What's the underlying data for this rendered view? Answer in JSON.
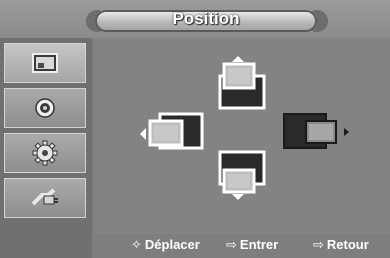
{
  "title": "Position",
  "sidebar": {
    "items": [
      {
        "icon": "picture-icon",
        "active": true
      },
      {
        "icon": "sound-icon",
        "active": false
      },
      {
        "icon": "setup-gear-icon",
        "active": false
      },
      {
        "icon": "input-plug-icon",
        "active": false
      }
    ]
  },
  "controls": {
    "up": "up-arrow-icon",
    "down": "down-arrow-icon",
    "left": "left-arrow-icon",
    "right": "right-arrow-icon"
  },
  "hints": {
    "move_glyph": "✧",
    "move": "Déplacer",
    "enter_glyph": "⇨",
    "enter": "Entrer",
    "back_glyph": "⇨",
    "back": "Retour"
  },
  "colors": {
    "background": "#828383",
    "text": "#ffffff"
  }
}
